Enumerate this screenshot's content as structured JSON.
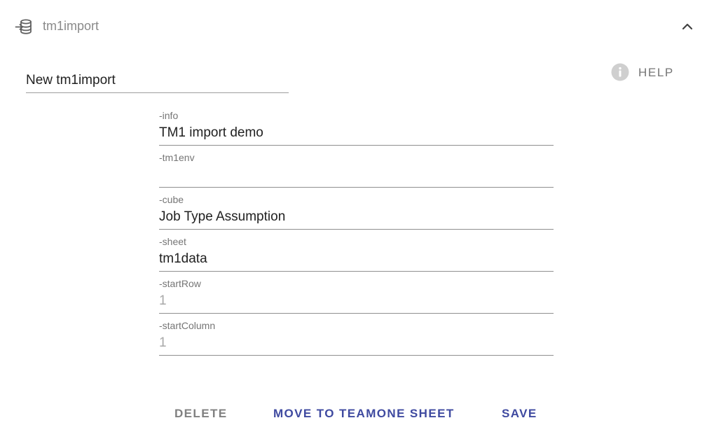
{
  "header": {
    "title": "tm1import",
    "icon": "import-database-icon",
    "collapse_icon": "chevron-up-icon"
  },
  "name_field": {
    "value": "New tm1import"
  },
  "help": {
    "label": "HELP",
    "icon": "info-icon"
  },
  "fields": [
    {
      "label": "-info",
      "value": "TM1 import demo",
      "is_placeholder": false
    },
    {
      "label": "-tm1env",
      "value": "",
      "is_placeholder": false
    },
    {
      "label": "-cube",
      "value": "Job Type Assumption",
      "is_placeholder": false
    },
    {
      "label": "-sheet",
      "value": "tm1data",
      "is_placeholder": false
    },
    {
      "label": "-startRow",
      "value": "1",
      "is_placeholder": true
    },
    {
      "label": "-startColumn",
      "value": "1",
      "is_placeholder": true
    }
  ],
  "actions": {
    "delete": "DELETE",
    "move": "MOVE TO TEAMONE SHEET",
    "save": "SAVE"
  },
  "colors": {
    "primary": "#3f4aa0",
    "muted": "#808080",
    "icon_gray": "#616161",
    "help_icon_bg": "#cfcfcf"
  }
}
